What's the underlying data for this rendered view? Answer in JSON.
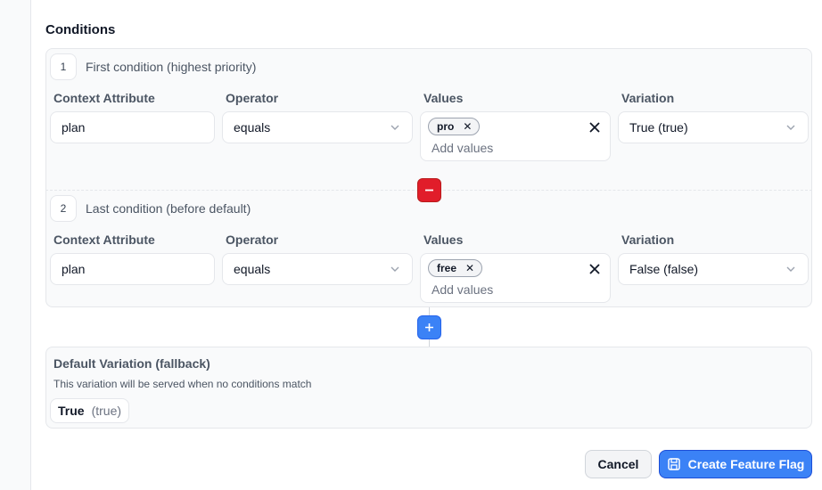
{
  "section": {
    "title": "Conditions"
  },
  "columns": {
    "attribute": "Context Attribute",
    "operator": "Operator",
    "values": "Values",
    "variation": "Variation"
  },
  "conditions": [
    {
      "number": "1",
      "title": "First condition (highest priority)",
      "attribute": "plan",
      "operator": "equals",
      "values": [
        "pro"
      ],
      "values_placeholder": "Add values",
      "variation": "True (true)"
    },
    {
      "number": "2",
      "title": "Last condition (before default)",
      "attribute": "plan",
      "operator": "equals",
      "values": [
        "free"
      ],
      "values_placeholder": "Add values",
      "variation": "False (false)"
    }
  ],
  "default_variation": {
    "title": "Default Variation (fallback)",
    "description": "This variation will be served when no conditions match",
    "value_label": "True",
    "value_sub": "(true)"
  },
  "actions": {
    "cancel": "Cancel",
    "create": "Create Feature Flag"
  },
  "icons": {
    "remove": "minus-icon",
    "add": "plus-icon",
    "dropdown": "chevron-down-icon",
    "clear": "close-icon",
    "save": "save-icon"
  },
  "colors": {
    "danger": "#e11d2a",
    "primary": "#3b82f6"
  }
}
